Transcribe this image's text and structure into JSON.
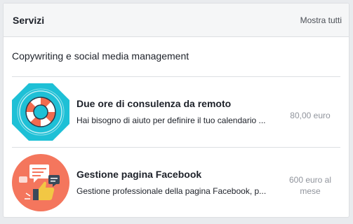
{
  "header": {
    "title": "Servizi",
    "see_all_label": "Mostra tutti"
  },
  "section": {
    "title": "Copywriting e social media management"
  },
  "services": [
    {
      "title": "Due ore di consulenza da remoto",
      "description": "Hai bisogno di aiuto per definire il tuo calendario ...",
      "price": "80,00 euro",
      "icon": "lifebuoy-icon",
      "icon_bg": "#1ec0d6"
    },
    {
      "title": "Gestione pagina Facebook",
      "description": "Gestione professionale della pagina Facebook, p...",
      "price": "600 euro al mese",
      "icon": "facebook-like-chat-icon",
      "icon_bg": "#f4765d"
    }
  ],
  "colors": {
    "page_bg": "#e9ebee",
    "header_bg": "#f5f6f7",
    "border": "#dddfe2",
    "price_text": "#90949c"
  }
}
